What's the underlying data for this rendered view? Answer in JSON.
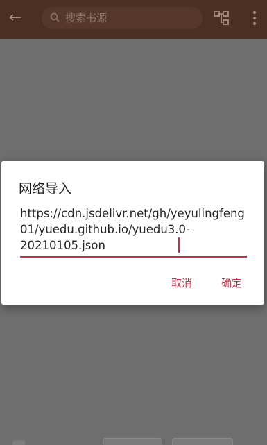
{
  "appbar": {
    "back_icon": "arrow-back-icon",
    "search_placeholder": "搜索书源",
    "search_icon": "search-icon",
    "tree_icon": "tree-group-icon",
    "more_icon": "more-vert-icon"
  },
  "dialog": {
    "title": "网络导入",
    "url_value": "https://cdn.jsdelivr.net/gh/yeyulingfeng01/yuedu.github.io/yuedu3.0-20210105.json",
    "cancel_label": "取消",
    "confirm_label": "确定"
  },
  "colors": {
    "appbar": "#4b2f21",
    "accent": "#c72d47",
    "scrim": "#6e6e6e"
  }
}
